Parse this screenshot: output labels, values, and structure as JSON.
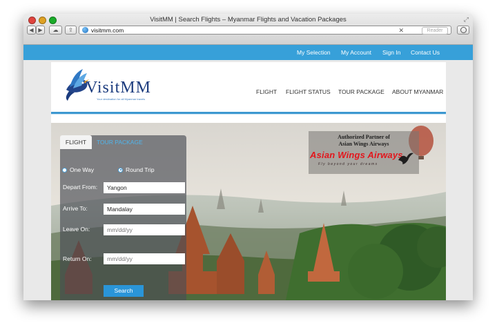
{
  "window": {
    "title": "VisitMM | Search Flights – Myanmar Flights and Vacation Packages",
    "url": "visitmm.com",
    "reader_label": "Reader"
  },
  "topnav": {
    "items": [
      "My Selection",
      "My Account",
      "Sign In",
      "Contact Us"
    ]
  },
  "site": {
    "logo_text": "VisitMM",
    "tagline": "Your destination for all Myanmar travels",
    "nav": [
      "FLIGHT",
      "FLIGHT STATUS",
      "TOUR PACKAGE",
      "ABOUT MYANMAR"
    ]
  },
  "search": {
    "tabs": [
      "FLIGHT",
      "TOUR PACKAGE"
    ],
    "trip_options": [
      "One Way",
      "Round Trip"
    ],
    "selected_trip": "Round Trip",
    "depart_label": "Depart From:",
    "depart_value": "Yangon",
    "arrive_label": "Arrive To:",
    "arrive_value": "Mandalay",
    "leave_label": "Leave On:",
    "leave_placeholder": "mm/dd/yy",
    "return_label": "Return On:",
    "return_placeholder": "mm/dd/yy",
    "button": "Search"
  },
  "partner": {
    "line1": "Authorized Partner of",
    "line2": "Asian Wings Airways",
    "brand": "Asian Wings Airways",
    "slogan": "Fly beyond your dreams"
  },
  "colors": {
    "nav_blue": "#37a0d9",
    "logo_navy": "#1c3c7e",
    "brand_red": "#e3161c",
    "button_blue": "#2a95d8"
  }
}
